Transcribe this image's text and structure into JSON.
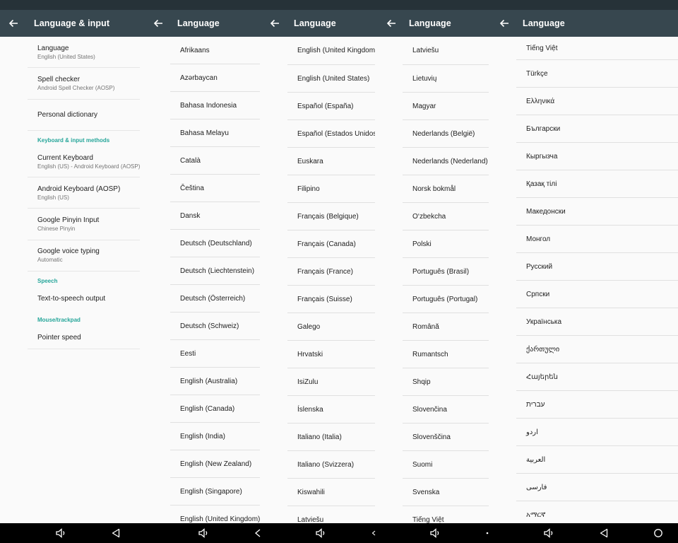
{
  "panels": [
    {
      "title": "Language & input",
      "settings": [
        {
          "type": "item",
          "title": "Language",
          "subtitle": "English (United States)"
        },
        {
          "type": "item",
          "title": "Spell checker",
          "subtitle": "Android Spell Checker (AOSP)"
        },
        {
          "type": "item",
          "title": "Personal dictionary",
          "subtitle": ""
        },
        {
          "type": "header",
          "title": "Keyboard & input methods"
        },
        {
          "type": "item",
          "title": "Current Keyboard",
          "subtitle": "English (US) - Android Keyboard (AOSP)"
        },
        {
          "type": "item",
          "title": "Android Keyboard (AOSP)",
          "subtitle": "English (US)"
        },
        {
          "type": "item",
          "title": "Google Pinyin Input",
          "subtitle": "Chinese Pinyin"
        },
        {
          "type": "item",
          "title": "Google voice typing",
          "subtitle": "Automatic"
        },
        {
          "type": "header",
          "title": "Speech"
        },
        {
          "type": "item",
          "title": "Text-to-speech output",
          "subtitle": ""
        },
        {
          "type": "header",
          "title": "Mouse/trackpad"
        },
        {
          "type": "item",
          "title": "Pointer speed",
          "subtitle": ""
        }
      ]
    },
    {
      "title": "Language",
      "items": [
        "Afrikaans",
        "Azərbaycan",
        "Bahasa Indonesia",
        "Bahasa Melayu",
        "Català",
        "Čeština",
        "Dansk",
        "Deutsch (Deutschland)",
        "Deutsch (Liechtenstein)",
        "Deutsch (Österreich)",
        "Deutsch (Schweiz)",
        "Eesti",
        "English (Australia)",
        "English (Canada)",
        "English (India)",
        "English (New Zealand)",
        "English (Singapore)",
        "English (United Kingdom)"
      ]
    },
    {
      "title": "Language",
      "items": [
        "English (United Kingdom)",
        "English (United States)",
        "Español (España)",
        "Español (Estados Unidos)",
        "Euskara",
        "Filipino",
        "Français (Belgique)",
        "Français (Canada)",
        "Français (France)",
        "Français (Suisse)",
        "Galego",
        "Hrvatski",
        "IsiZulu",
        "Íslenska",
        "Italiano (Italia)",
        "Italiano (Svizzera)",
        "Kiswahili",
        "Latviešu"
      ]
    },
    {
      "title": "Language",
      "items": [
        "Latviešu",
        "Lietuvių",
        "Magyar",
        "Nederlands (België)",
        "Nederlands (Nederland)",
        "Norsk bokmål",
        "O‘zbekcha",
        "Polski",
        "Português (Brasil)",
        "Português (Portugal)",
        "Română",
        "Rumantsch",
        "Shqip",
        "Slovenčina",
        "Slovenščina",
        "Suomi",
        "Svenska",
        "Tiếng Việt"
      ]
    },
    {
      "title": "Language",
      "items": [
        "Tiếng Việt",
        "Türkçe",
        "Ελληνικά",
        "Български",
        "Кыргызча",
        "Қазақ тілі",
        "Македонски",
        "Монгол",
        "Русский",
        "Српски",
        "Українська",
        "ქართული",
        "Հայերեն",
        "עברית",
        "اردو",
        "العربية",
        "فارسی",
        "አማርኛ"
      ]
    }
  ],
  "icons": {
    "back": "arrow-left-icon",
    "volume": "volume-icon",
    "nav_back": "triangle-back-icon",
    "home": "circle-home-icon"
  },
  "colors": {
    "appbar": "#37474f",
    "status_bar": "#263238",
    "accent": "#26a69a",
    "background": "#fafafa",
    "nav_bar": "#000000"
  }
}
